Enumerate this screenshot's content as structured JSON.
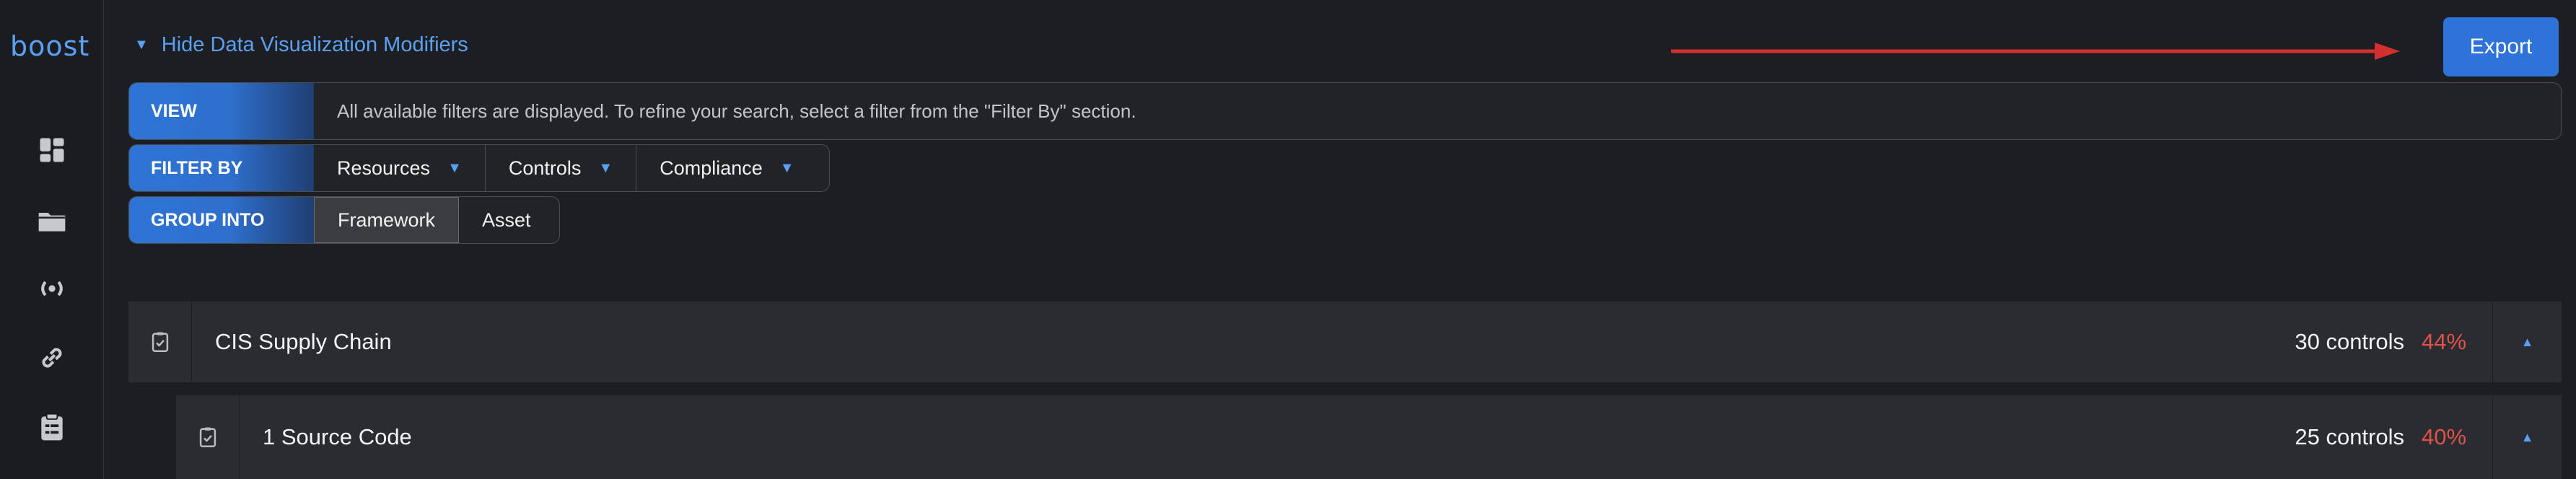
{
  "app": {
    "logo_text": "boost"
  },
  "sidebar": {
    "icons": [
      "dashboard-icon",
      "folder-icon",
      "broadcast-icon",
      "link-icon",
      "clipboard-icon"
    ]
  },
  "toolbar": {
    "toggle_label": "Hide Data Visualization Modifiers",
    "export_label": "Export"
  },
  "modifiers": {
    "view": {
      "label": "VIEW",
      "text": "All available filters are displayed. To refine your search, select a filter from the \"Filter By\" section."
    },
    "filter_by": {
      "label": "FILTER BY",
      "options": [
        "Resources",
        "Controls",
        "Compliance"
      ]
    },
    "group_into": {
      "label": "GROUP INTO",
      "options": [
        "Framework",
        "Asset"
      ],
      "selected": "Framework"
    }
  },
  "frameworks": [
    {
      "title": "CIS Supply Chain",
      "controls": "30 controls",
      "percent": "44%"
    },
    {
      "title": "1 Source Code",
      "controls": "25 controls",
      "percent": "40%"
    }
  ],
  "colors": {
    "accent": "#2d73d8",
    "link": "#5aa0f5",
    "danger": "#e0524a",
    "arrow": "#d32f2f"
  }
}
